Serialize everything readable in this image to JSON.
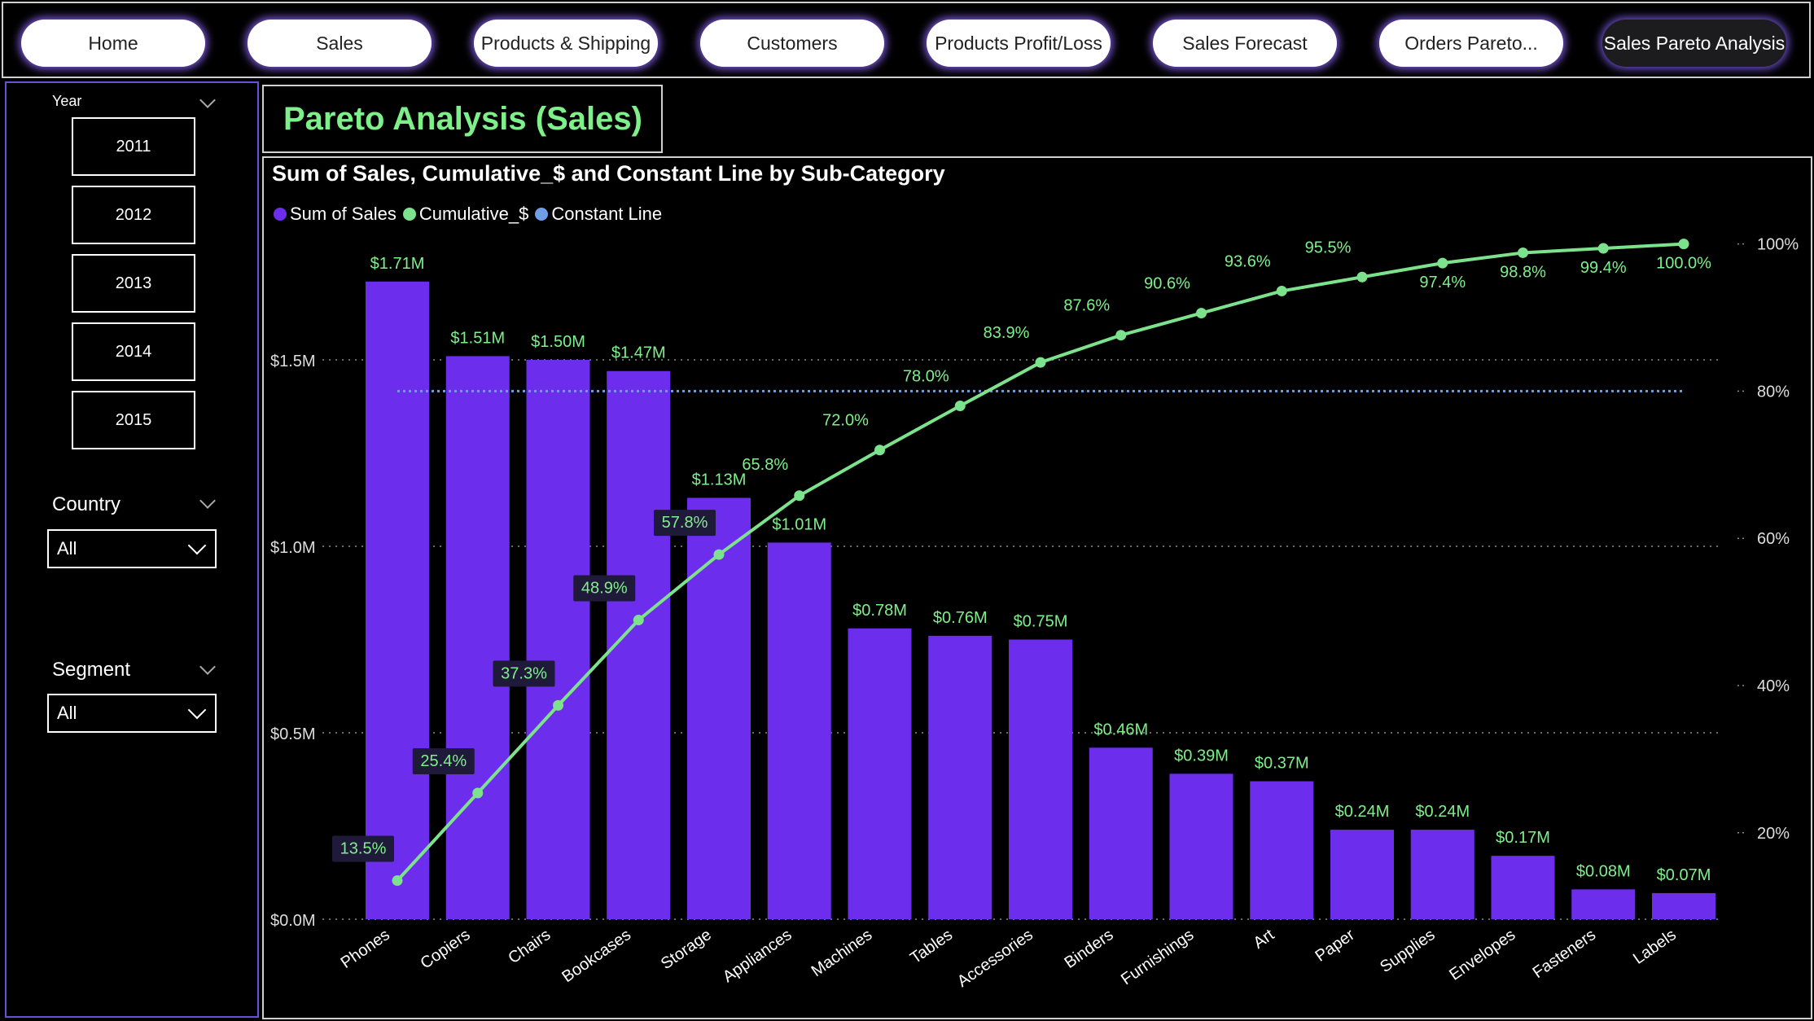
{
  "nav": {
    "tabs": [
      {
        "label": "Home",
        "active": false
      },
      {
        "label": "Sales",
        "active": false
      },
      {
        "label": "Products & Shipping",
        "active": false
      },
      {
        "label": "Customers",
        "active": false
      },
      {
        "label": "Products Profit/Loss",
        "active": false
      },
      {
        "label": "Sales Forecast",
        "active": false
      },
      {
        "label": "Orders Pareto...",
        "active": false
      },
      {
        "label": "Sales Pareto Analysis",
        "active": true
      }
    ]
  },
  "filters": {
    "year_label": "Year",
    "years": [
      "2011",
      "2012",
      "2013",
      "2014",
      "2015"
    ],
    "country_label": "Country",
    "country_value": "All",
    "segment_label": "Segment",
    "segment_value": "All"
  },
  "page_title": "Pareto Analysis (Sales)",
  "colors": {
    "bar": "#6d2ded",
    "cumulative": "#7ce38c",
    "constant": "#6f9ee8",
    "label_green": "#7ef08a",
    "grid": "#8a8a8a"
  },
  "chart_data": {
    "type": "bar",
    "title": "Sum of Sales, Cumulative_$ and Constant Line by Sub-Category",
    "categories": [
      "Phones",
      "Copiers",
      "Chairs",
      "Bookcases",
      "Storage",
      "Appliances",
      "Machines",
      "Tables",
      "Accessories",
      "Binders",
      "Furnishings",
      "Art",
      "Paper",
      "Supplies",
      "Envelopes",
      "Fasteners",
      "Labels"
    ],
    "series": [
      {
        "name": "Sum of Sales",
        "axis": "left",
        "values": [
          1.71,
          1.51,
          1.5,
          1.47,
          1.13,
          1.01,
          0.78,
          0.76,
          0.75,
          0.46,
          0.39,
          0.37,
          0.24,
          0.24,
          0.17,
          0.08,
          0.07
        ],
        "labels": [
          "$1.71M",
          "$1.51M",
          "$1.50M",
          "$1.47M",
          "$1.13M",
          "$1.01M",
          "$0.78M",
          "$0.76M",
          "$0.75M",
          "$0.46M",
          "$0.39M",
          "$0.37M",
          "$0.24M",
          "$0.24M",
          "$0.17M",
          "$0.08M",
          "$0.07M"
        ]
      },
      {
        "name": "Cumulative_$",
        "axis": "right",
        "type": "line",
        "values": [
          13.5,
          25.4,
          37.3,
          48.9,
          57.8,
          65.8,
          72.0,
          78.0,
          83.9,
          87.6,
          90.6,
          93.6,
          95.5,
          97.4,
          98.8,
          99.4,
          100.0
        ],
        "labels": [
          "13.5%",
          "25.4%",
          "37.3%",
          "48.9%",
          "57.8%",
          "65.8%",
          "72.0%",
          "78.0%",
          "83.9%",
          "87.6%",
          "90.6%",
          "93.6%",
          "95.5%",
          "97.4%",
          "98.8%",
          "99.4%",
          "100.0%"
        ]
      },
      {
        "name": "Constant Line",
        "axis": "right",
        "type": "line",
        "value": 80
      }
    ],
    "left_axis": {
      "ylim": [
        0,
        1.8
      ],
      "ticks": [
        0,
        0.5,
        1.0,
        1.5
      ],
      "tick_labels": [
        "$0.0M",
        "$0.5M",
        "$1.0M",
        "$1.5M"
      ]
    },
    "right_axis": {
      "ylim": [
        9,
        104
      ],
      "ticks": [
        20,
        40,
        60,
        80,
        100
      ],
      "tick_labels": [
        "20%",
        "40%",
        "60%",
        "80%",
        "100%"
      ]
    },
    "grid": true,
    "legend_position": "top-left"
  }
}
